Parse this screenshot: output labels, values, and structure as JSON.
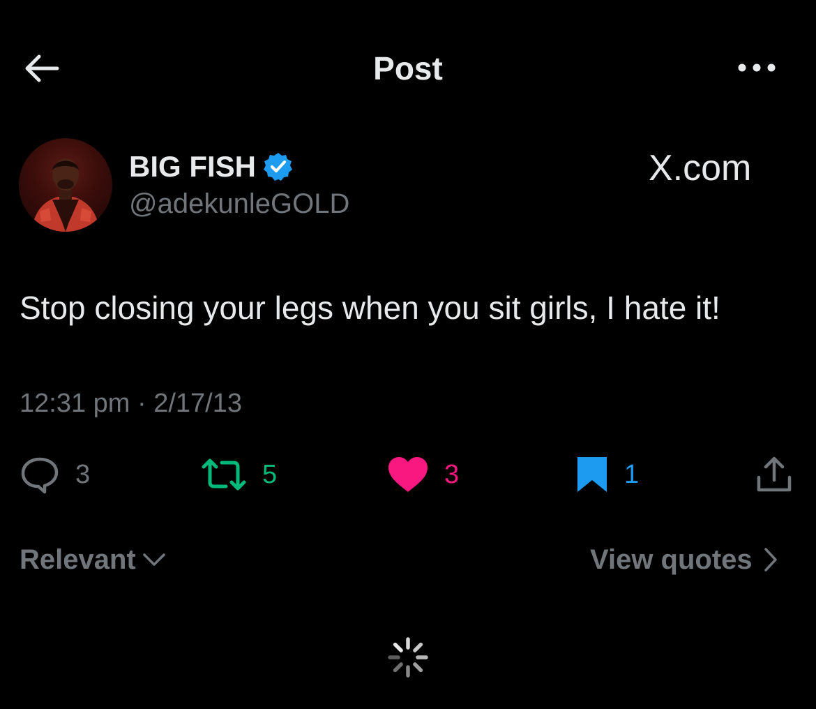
{
  "header": {
    "title": "Post",
    "back_icon": "arrow-left-icon",
    "more_icon": "more-horizontal-icon"
  },
  "author": {
    "display_name": "BIG FISH",
    "handle": "@adekunleGOLD",
    "verified": true,
    "verified_icon": "verified-badge-icon",
    "avatar": "avatar"
  },
  "source": {
    "label": "X.com"
  },
  "post": {
    "text": "Stop closing your legs when you sit girls, I hate it!",
    "meta": "12:31 pm · 2/17/13"
  },
  "actions": {
    "reply": {
      "icon": "reply-bubble-icon",
      "count": "3"
    },
    "repost": {
      "icon": "repost-icon",
      "count": "5"
    },
    "like": {
      "icon": "heart-filled-icon",
      "count": "3"
    },
    "bookmark": {
      "icon": "bookmark-filled-icon",
      "count": "1"
    },
    "share": {
      "icon": "share-icon"
    }
  },
  "replies_bar": {
    "sort_label": "Relevant",
    "view_quotes_label": "View quotes"
  },
  "colors": {
    "background": "#000000",
    "primary_text": "#e7e9ea",
    "secondary_text": "#71767b",
    "repost_green": "#00ba7c",
    "like_pink": "#f91880",
    "bookmark_blue": "#1d9bf0",
    "verified_blue": "#1d9bf0"
  }
}
